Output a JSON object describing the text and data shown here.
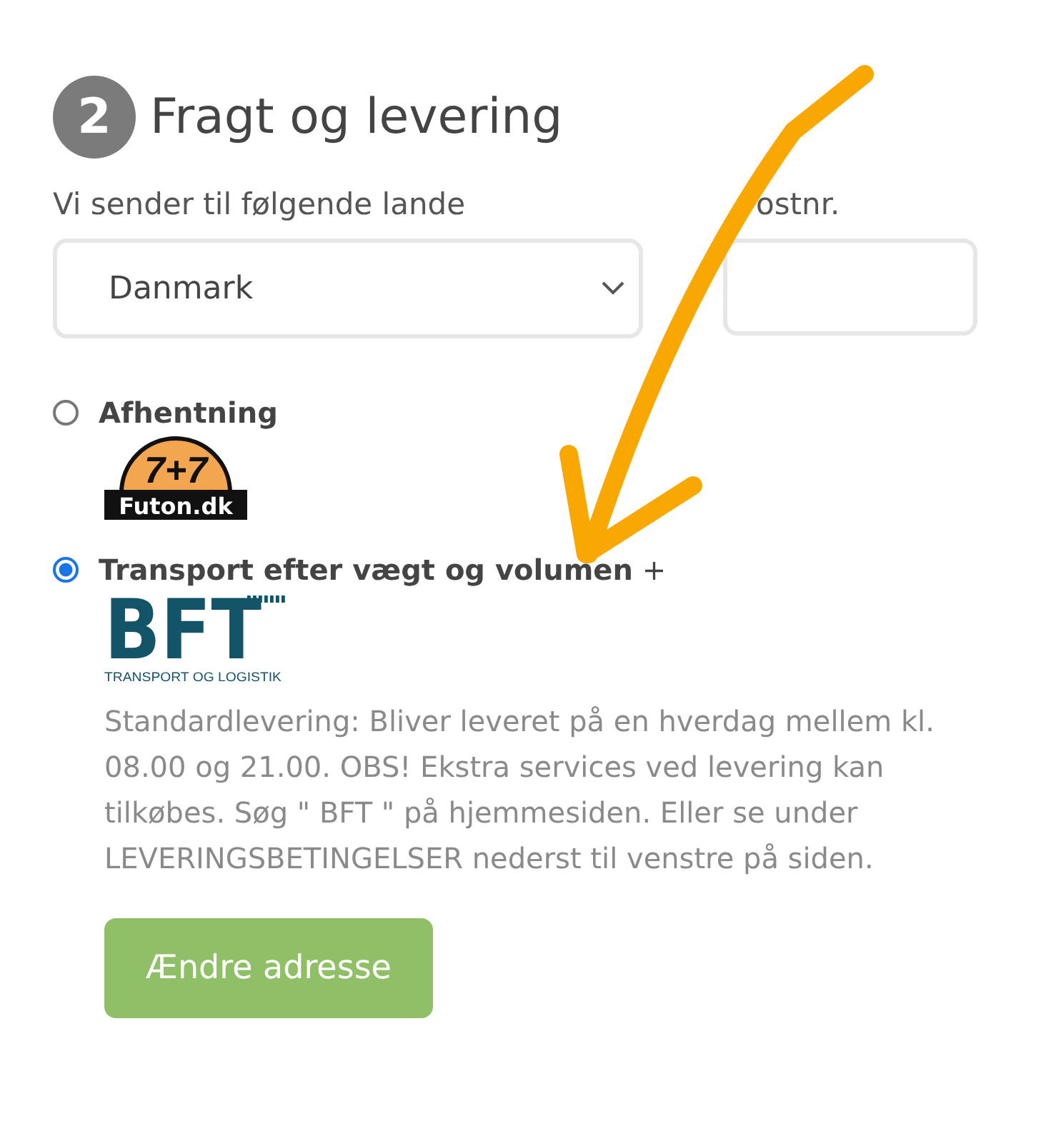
{
  "section": {
    "number": "2",
    "title": "Fragt og levering"
  },
  "country": {
    "label": "Vi sender til følgende lande",
    "value": "Danmark"
  },
  "postcode": {
    "label": "ostnr."
  },
  "options": [
    {
      "label": "Afhentning",
      "selected": false,
      "logo": {
        "kind": "futon",
        "top": "7+7",
        "bottom": "Futon.dk"
      }
    },
    {
      "label": "Transport efter vægt og volumen",
      "suffix": "+",
      "selected": true,
      "logo": {
        "kind": "bft",
        "top": "BFT",
        "bottom": "TRANSPORT OG LOGISTIK"
      },
      "description": "Standardlevering: Bliver leveret på en hverdag mellem kl. 08.00 og 21.00. OBS! Ekstra services ved levering kan tilkøbes. Søg \" BFT \" på hjemmesiden. Eller se under LEVERINGSBETINGELSER nederst til venstre på siden."
    }
  ],
  "button": "Ændre adresse"
}
